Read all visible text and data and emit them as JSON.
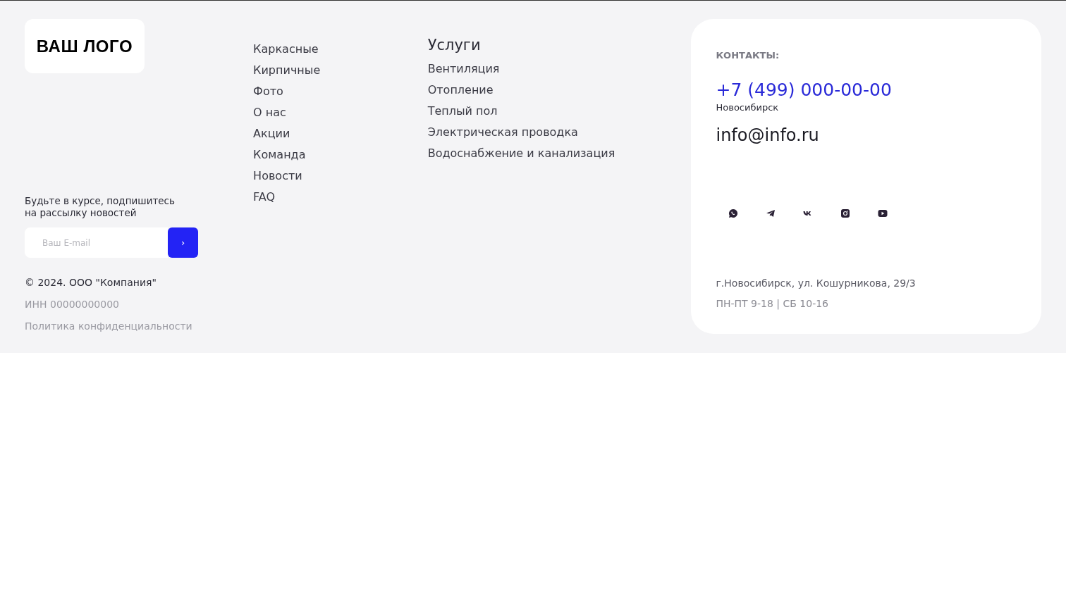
{
  "logo": {
    "text": "ВАШ ЛОГО"
  },
  "subscribe": {
    "text": "Будьте в курсе, подпишитесь на рассылку новостей",
    "placeholder": "Ваш E-mail",
    "button": "›"
  },
  "legal": {
    "copyright": "© 2024. ООО \"Компания\"",
    "inn": "ИНН 00000000000",
    "privacy": "Политика конфиденциальности"
  },
  "menu": [
    "Каркасные",
    "Кирпичные",
    "Фото",
    "О нас",
    "Акции",
    "Команда",
    "Новости",
    "FAQ"
  ],
  "services": {
    "title": "Услуги",
    "items": [
      "Вентиляция",
      "Отопление",
      "Теплый пол",
      "Электрическая проводка",
      "Водоснабжение и канализация"
    ]
  },
  "contacts": {
    "title": "КОНТАКТЫ:",
    "phone": "+7 (499) 000-00-00",
    "city": "Новосибирск",
    "email": "info@info.ru",
    "socials": [
      {
        "kind": "whatsapp"
      },
      {
        "kind": "telegram"
      },
      {
        "kind": "vk"
      },
      {
        "kind": "instagram"
      },
      {
        "kind": "youtube"
      }
    ],
    "address": "г.Новосибирск, ул. Кошурникова, 29/3",
    "hours": "ПН-ПТ 9-18 | СБ 10-16"
  }
}
